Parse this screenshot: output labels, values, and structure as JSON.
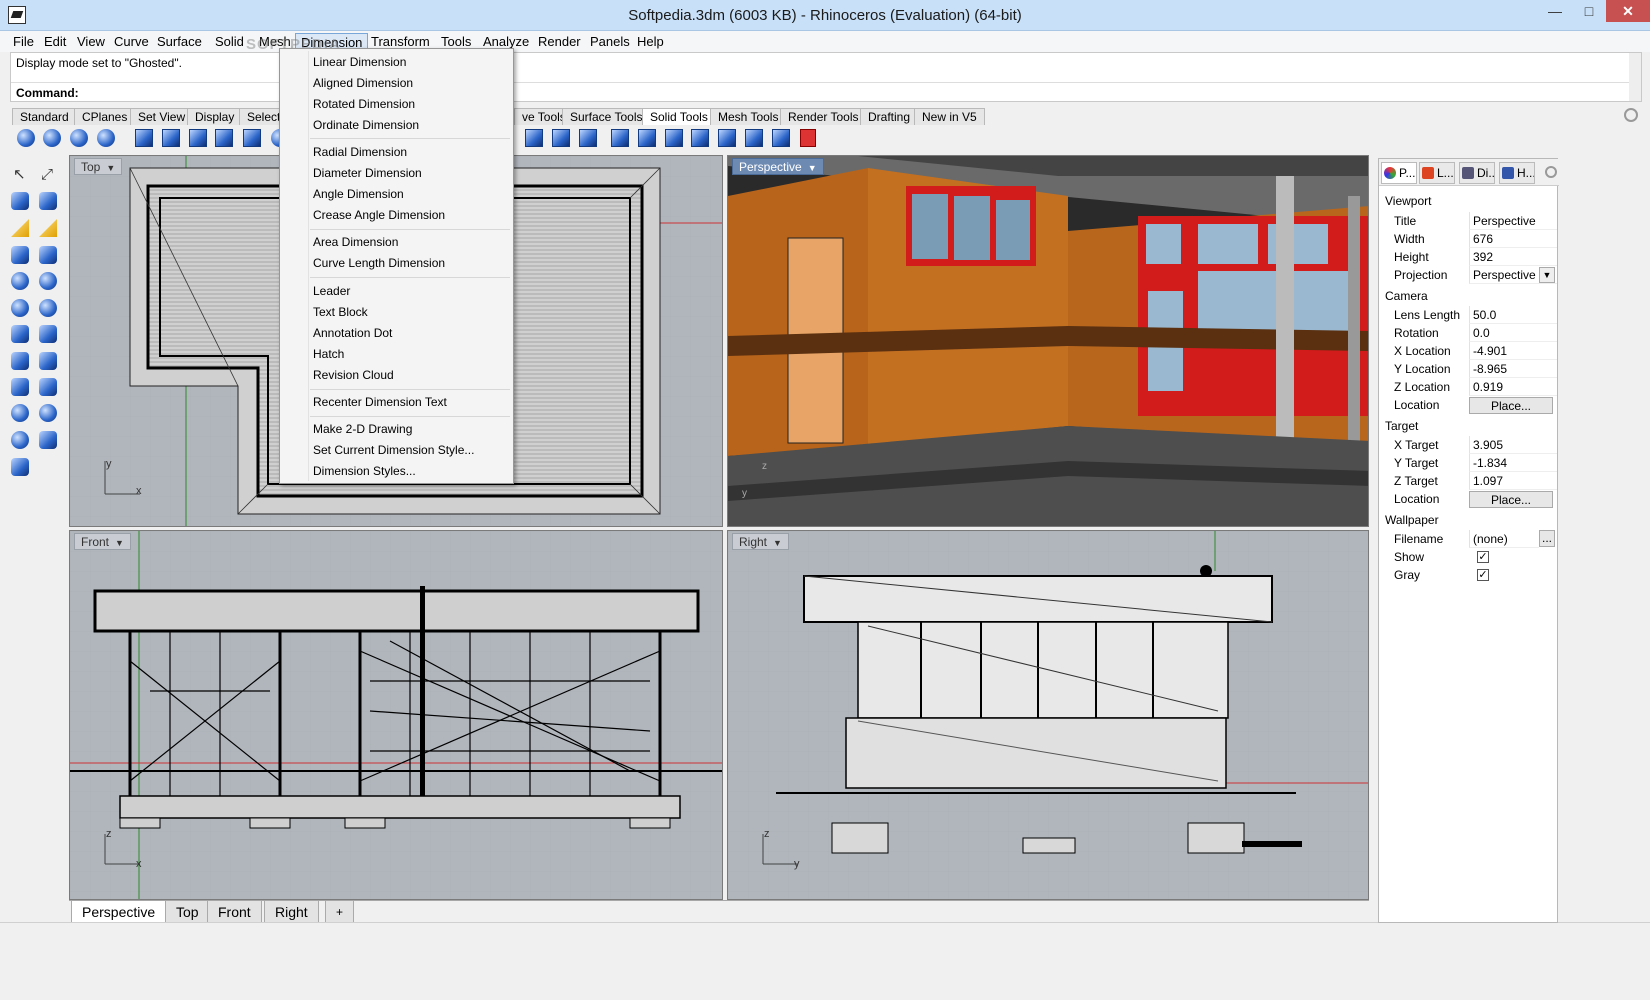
{
  "window": {
    "title": "Softpedia.3dm (6003 KB) - Rhinoceros (Evaluation) (64-bit)",
    "min": "—",
    "max": "□",
    "close": "✕"
  },
  "menubar": {
    "items": [
      "File",
      "Edit",
      "View",
      "Curve",
      "Surface",
      "Solid",
      "Mesh",
      "Dimension",
      "Transform",
      "Tools",
      "Analyze",
      "Render",
      "Panels",
      "Help"
    ]
  },
  "command": {
    "history": "Display mode set to \"Ghosted\".",
    "prompt": "Command:"
  },
  "toolbar_tabs": [
    "Standard",
    "CPlanes",
    "Set View",
    "Display",
    "Select",
    "ve Tools",
    "Surface Tools",
    "Solid Tools",
    "Mesh Tools",
    "Render Tools",
    "Drafting",
    "New in V5"
  ],
  "dimension_menu": {
    "items": [
      "Linear Dimension",
      "Aligned Dimension",
      "Rotated Dimension",
      "Ordinate Dimension",
      "Radial Dimension",
      "Diameter Dimension",
      "Angle Dimension",
      "Crease Angle Dimension",
      "Area Dimension",
      "Curve Length Dimension",
      "Leader",
      "Text Block",
      "Annotation Dot",
      "Hatch",
      "Revision Cloud",
      "Recenter Dimension Text",
      "Make 2-D Drawing",
      "Set Current Dimension Style...",
      "Dimension Styles..."
    ]
  },
  "viewports": {
    "top": "Top",
    "perspective": "Perspective",
    "front": "Front",
    "right": "Right"
  },
  "axes": {
    "x": "x",
    "y": "y",
    "z": "z"
  },
  "bottom_tabs": [
    "Perspective",
    "Top",
    "Front",
    "Right",
    "+"
  ],
  "panel": {
    "tabs": [
      "P...",
      "L...",
      "Di...",
      "H..."
    ],
    "viewport_section": "Viewport",
    "title_label": "Title",
    "title_value": "Perspective",
    "width_label": "Width",
    "width_value": "676",
    "height_label": "Height",
    "height_value": "392",
    "projection_label": "Projection",
    "projection_value": "Perspective",
    "camera_section": "Camera",
    "lens_label": "Lens Length",
    "lens_value": "50.0",
    "rotation_label": "Rotation",
    "rotation_value": "0.0",
    "xloc_label": "X Location",
    "xloc_value": "-4.901",
    "yloc_label": "Y Location",
    "yloc_value": "-8.965",
    "zloc_label": "Z Location",
    "zloc_value": "0.919",
    "location_label": "Location",
    "place_label": "Place...",
    "target_section": "Target",
    "xt_label": "X Target",
    "xt_value": "3.905",
    "yt_label": "Y Target",
    "yt_value": "-1.834",
    "zt_label": "Z Target",
    "zt_value": "1.097",
    "tloc_label": "Location",
    "tplace_label": "Place...",
    "wallpaper_section": "Wallpaper",
    "filename_label": "Filename",
    "filename_value": "(none)",
    "browse_label": "...",
    "show_label": "Show",
    "gray_label": "Gray",
    "check": "✓"
  },
  "watermark": "SOFTPEDIA"
}
